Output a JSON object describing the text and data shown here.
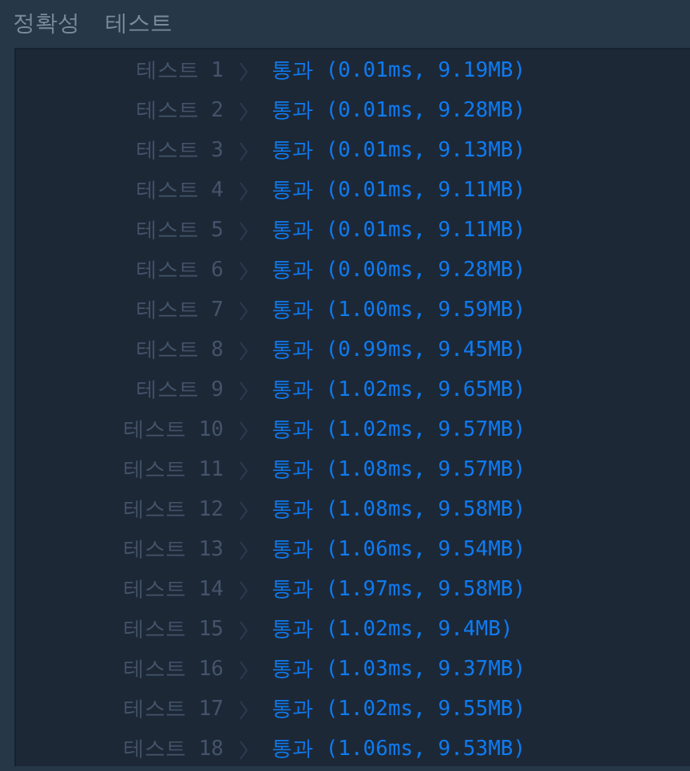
{
  "header": {
    "section": "정확성",
    "title": "테스트"
  },
  "results": [
    {
      "label": "테스트 1",
      "result": "통과 (0.01ms, 9.19MB)"
    },
    {
      "label": "테스트 2",
      "result": "통과 (0.01ms, 9.28MB)"
    },
    {
      "label": "테스트 3",
      "result": "통과 (0.01ms, 9.13MB)"
    },
    {
      "label": "테스트 4",
      "result": "통과 (0.01ms, 9.11MB)"
    },
    {
      "label": "테스트 5",
      "result": "통과 (0.01ms, 9.11MB)"
    },
    {
      "label": "테스트 6",
      "result": "통과 (0.00ms, 9.28MB)"
    },
    {
      "label": "테스트 7",
      "result": "통과 (1.00ms, 9.59MB)"
    },
    {
      "label": "테스트 8",
      "result": "통과 (0.99ms, 9.45MB)"
    },
    {
      "label": "테스트 9",
      "result": "통과 (1.02ms, 9.65MB)"
    },
    {
      "label": "테스트 10",
      "result": "통과 (1.02ms, 9.57MB)"
    },
    {
      "label": "테스트 11",
      "result": "통과 (1.08ms, 9.57MB)"
    },
    {
      "label": "테스트 12",
      "result": "통과 (1.08ms, 9.58MB)"
    },
    {
      "label": "테스트 13",
      "result": "통과 (1.06ms, 9.54MB)"
    },
    {
      "label": "테스트 14",
      "result": "통과 (1.97ms, 9.58MB)"
    },
    {
      "label": "테스트 15",
      "result": "통과 (1.02ms, 9.4MB)"
    },
    {
      "label": "테스트 16",
      "result": "통과 (1.03ms, 9.37MB)"
    },
    {
      "label": "테스트 17",
      "result": "통과 (1.02ms, 9.55MB)"
    },
    {
      "label": "테스트 18",
      "result": "통과 (1.06ms, 9.53MB)"
    }
  ]
}
